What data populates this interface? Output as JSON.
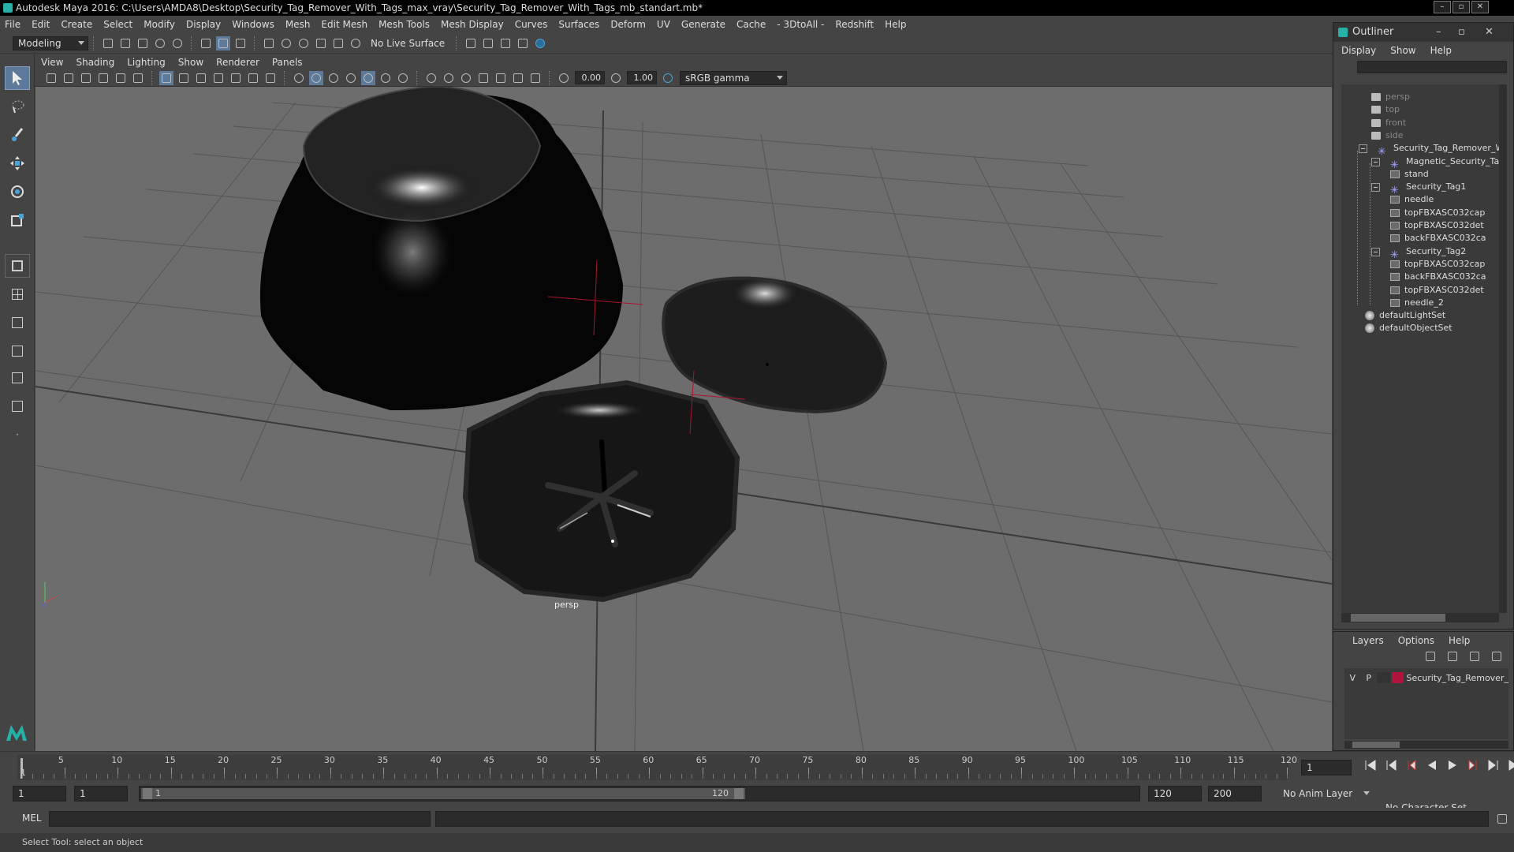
{
  "window": {
    "title": "Autodesk Maya 2016: C:\\Users\\AMDA8\\Desktop\\Security_Tag_Remover_With_Tags_max_vray\\Security_Tag_Remover_With_Tags_mb_standart.mb*"
  },
  "menubar": [
    "File",
    "Edit",
    "Create",
    "Select",
    "Modify",
    "Display",
    "Windows",
    "Mesh",
    "Edit Mesh",
    "Mesh Tools",
    "Mesh Display",
    "Curves",
    "Surfaces",
    "Deform",
    "UV",
    "Generate",
    "Cache",
    "- 3DtoAll -",
    "Redshift",
    "Help"
  ],
  "shelf": {
    "mode": "Modeling",
    "live_surface": "No Live Surface"
  },
  "viewport": {
    "menu": [
      "View",
      "Shading",
      "Lighting",
      "Show",
      "Renderer",
      "Panels"
    ],
    "exposure": "0.00",
    "gamma": "1.00",
    "color_space": "sRGB gamma",
    "camera_label": "persp"
  },
  "outliner": {
    "title": "Outliner",
    "menu": [
      "Display",
      "Show",
      "Help"
    ],
    "items": [
      {
        "label": "persp",
        "depth": 1,
        "type": "camera",
        "dim": true
      },
      {
        "label": "top",
        "depth": 1,
        "type": "camera",
        "dim": true
      },
      {
        "label": "front",
        "depth": 1,
        "type": "camera",
        "dim": true
      },
      {
        "label": "side",
        "depth": 1,
        "type": "camera",
        "dim": true
      },
      {
        "label": "Security_Tag_Remover_Wi",
        "depth": 0,
        "type": "group",
        "expand": true
      },
      {
        "label": "Magnetic_Security_Tag",
        "depth": 1,
        "type": "group",
        "expand": true
      },
      {
        "label": "stand",
        "depth": 2,
        "type": "mesh"
      },
      {
        "label": "Security_Tag1",
        "depth": 1,
        "type": "group",
        "expand": true
      },
      {
        "label": "needle",
        "depth": 2,
        "type": "mesh"
      },
      {
        "label": "topFBXASC032cap",
        "depth": 2,
        "type": "mesh"
      },
      {
        "label": "topFBXASC032det",
        "depth": 2,
        "type": "mesh"
      },
      {
        "label": "backFBXASC032ca",
        "depth": 2,
        "type": "mesh"
      },
      {
        "label": "Security_Tag2",
        "depth": 1,
        "type": "group",
        "expand": true
      },
      {
        "label": "topFBXASC032cap",
        "depth": 2,
        "type": "mesh"
      },
      {
        "label": "backFBXASC032ca",
        "depth": 2,
        "type": "mesh"
      },
      {
        "label": "topFBXASC032det",
        "depth": 2,
        "type": "mesh"
      },
      {
        "label": "needle_2",
        "depth": 2,
        "type": "mesh"
      },
      {
        "label": "defaultLightSet",
        "depth": 0,
        "type": "set"
      },
      {
        "label": "defaultObjectSet",
        "depth": 0,
        "type": "set"
      }
    ]
  },
  "layers": {
    "menu": [
      "Layers",
      "Options",
      "Help"
    ],
    "rows": [
      {
        "v": "V",
        "p": "P",
        "color": "#b0143c",
        "name": "Security_Tag_Remover_"
      }
    ]
  },
  "timeline": {
    "ticks": [
      "5",
      "10",
      "15",
      "20",
      "25",
      "30",
      "35",
      "40",
      "45",
      "50",
      "55",
      "60",
      "65",
      "70",
      "75",
      "80",
      "85",
      "90",
      "95",
      "100",
      "105",
      "110",
      "115",
      "120"
    ],
    "start_label": "1",
    "current_frame": "1"
  },
  "range": {
    "start": "1",
    "playback_start": "1",
    "slider_start": "1",
    "slider_end": "120",
    "playback_end": "120",
    "end": "200",
    "anim_layer": "No Anim Layer",
    "character_set": "No Character Set"
  },
  "command": {
    "lang": "MEL"
  },
  "help_line": "Select Tool: select an object"
}
